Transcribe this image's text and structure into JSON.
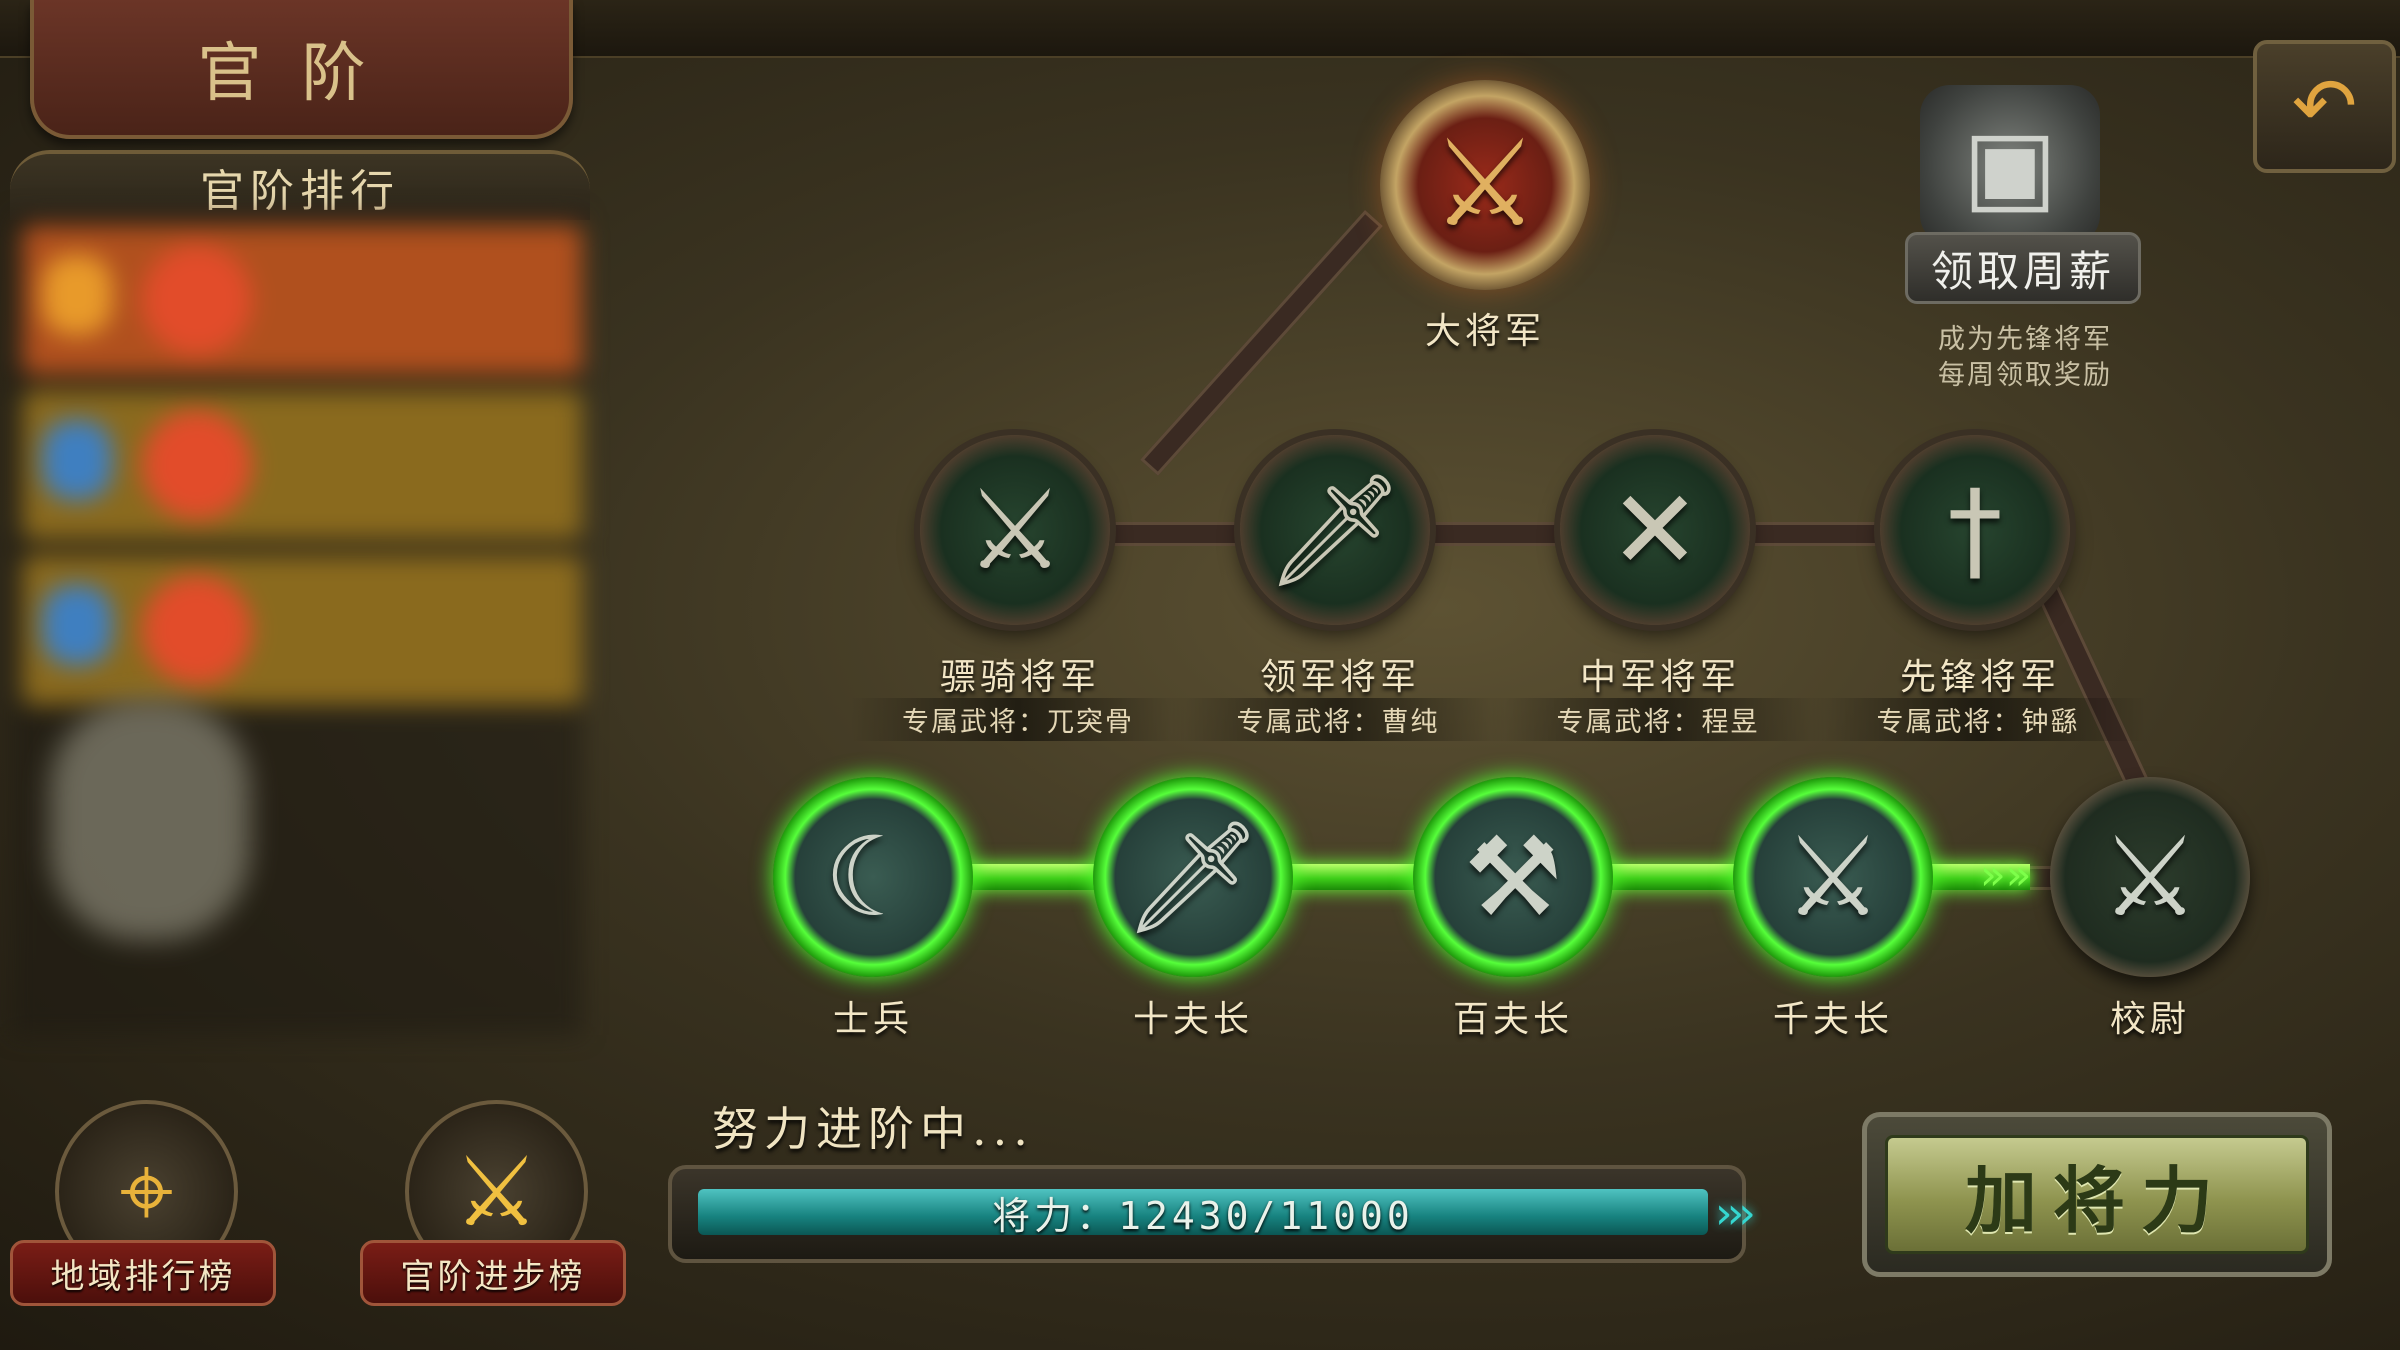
{
  "header": {
    "title": "官阶"
  },
  "sidebar": {
    "ranking_title": "官阶排行"
  },
  "ranks": {
    "top": {
      "label": "大将军"
    },
    "generals": [
      {
        "label": "骠骑将军",
        "exclusive": "专属武将：兀突骨",
        "icon": "crossed-swords"
      },
      {
        "label": "领军将军",
        "exclusive": "专属武将：曹纯",
        "icon": "triple-swords"
      },
      {
        "label": "中军将军",
        "exclusive": "专属武将：程昱",
        "icon": "crossed-blades"
      },
      {
        "label": "先锋将军",
        "exclusive": "专属武将：钟繇",
        "icon": "single-sword"
      }
    ],
    "lower": [
      {
        "label": "士兵",
        "icon": "sickle",
        "unlocked": true
      },
      {
        "label": "十夫长",
        "icon": "dagger",
        "unlocked": true
      },
      {
        "label": "百夫长",
        "icon": "halberd",
        "unlocked": true
      },
      {
        "label": "千夫长",
        "icon": "broadsword",
        "unlocked": true
      },
      {
        "label": "校尉",
        "icon": "glaive",
        "unlocked": false
      }
    ]
  },
  "weekly_reward": {
    "button_label": "领取周薪",
    "note_line1": "成为先锋将军",
    "note_line2": "每周领取奖励"
  },
  "bottom_buttons": {
    "region_rank": "地域排行榜",
    "progress_rank": "官阶进步榜"
  },
  "progress": {
    "caption": "努力进阶中...",
    "text": "将力：12430/11000",
    "current": 12430,
    "max": 11000,
    "fill_fraction": 1.0
  },
  "actions": {
    "add_power": "加将力"
  },
  "colors": {
    "accent_green": "#52ff2e",
    "progress_teal": "#17827f",
    "title_red": "#6b3527"
  }
}
